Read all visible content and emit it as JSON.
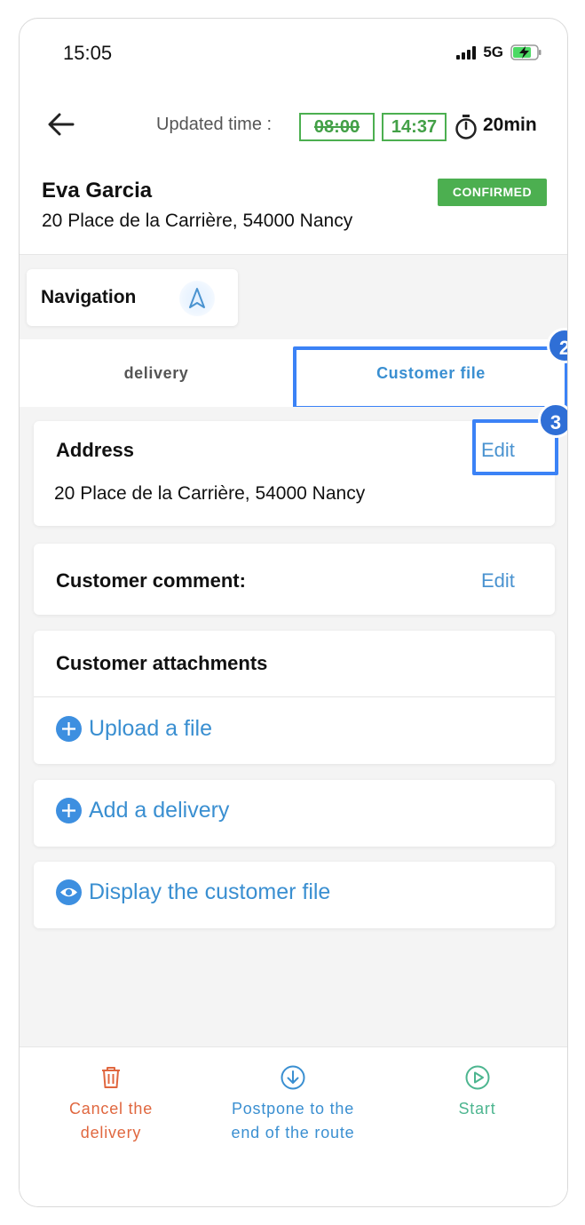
{
  "status_bar": {
    "time": "15:05",
    "network": "5G"
  },
  "header": {
    "updated_label": "Updated time :",
    "old_time": "08:00",
    "new_time": "14:37",
    "duration": "20min"
  },
  "customer": {
    "name": "Eva Garcia",
    "status_badge": "CONFIRMED",
    "address": "20 Place de la Carrière, 54000 Nancy"
  },
  "navigation": {
    "label": "Navigation"
  },
  "tabs": [
    {
      "label": "delivery",
      "active": false
    },
    {
      "label": "Customer file",
      "active": true
    }
  ],
  "annotations": {
    "tab_marker": "2",
    "edit_marker": "3"
  },
  "address_card": {
    "title": "Address",
    "edit_label": "Edit",
    "value": "20 Place de la Carrière, 54000 Nancy"
  },
  "comment_card": {
    "title": "Customer comment:",
    "edit_label": "Edit"
  },
  "attachments_card": {
    "title": "Customer attachments",
    "upload_label": "Upload a file"
  },
  "add_delivery": {
    "label": "Add a delivery"
  },
  "display_file": {
    "label": "Display the customer file"
  },
  "bottom_actions": {
    "cancel": {
      "line1": "Cancel the",
      "line2": "delivery",
      "color": "#e0673f",
      "icon": "trash-icon"
    },
    "postpone": {
      "line1": "Postpone to the",
      "line2": "end of the route",
      "color": "#3a8fd1",
      "icon": "arrow-down-circle-icon"
    },
    "start": {
      "label": "Start",
      "color": "#4cb58f",
      "icon": "play-circle-icon"
    }
  },
  "colors": {
    "accent": "#3a8fd1",
    "confirmed": "#4caf50",
    "highlight": "#3b82f6"
  }
}
